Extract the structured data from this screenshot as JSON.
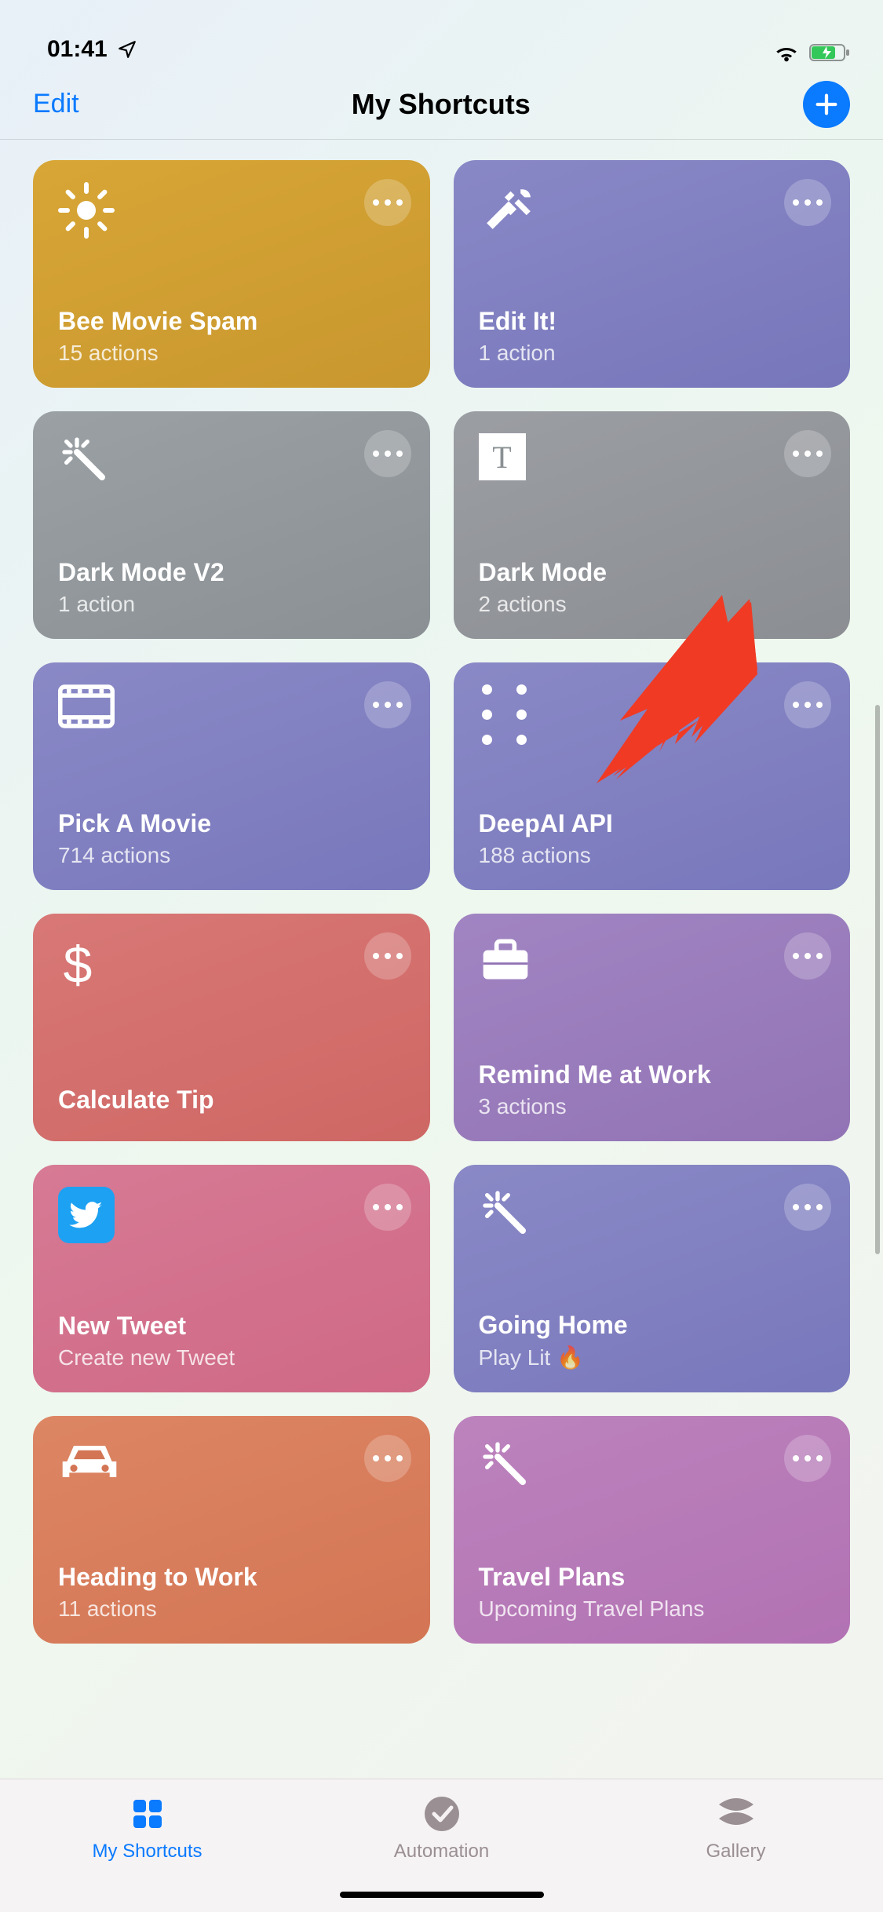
{
  "status": {
    "time": "01:41"
  },
  "nav": {
    "edit": "Edit",
    "title": "My Shortcuts"
  },
  "shortcuts": [
    {
      "title": "Bee Movie Spam",
      "sub": "15 actions",
      "color": "c-gold",
      "icon": "sun"
    },
    {
      "title": "Edit It!",
      "sub": "1 action",
      "color": "c-purple",
      "icon": "hammer-wrench"
    },
    {
      "title": "Dark Mode V2",
      "sub": "1 action",
      "color": "c-gray",
      "icon": "wand"
    },
    {
      "title": "Dark Mode",
      "sub": "2 actions",
      "color": "c-gray2",
      "icon": "text-box"
    },
    {
      "title": "Pick A Movie",
      "sub": "714 actions",
      "color": "c-purple2",
      "icon": "film"
    },
    {
      "title": "DeepAI API",
      "sub": "188 actions",
      "color": "c-purple2",
      "icon": "six-dots"
    },
    {
      "title": "Calculate Tip",
      "sub": "",
      "color": "c-red",
      "icon": "dollar"
    },
    {
      "title": "Remind Me at Work",
      "sub": "3 actions",
      "color": "c-violet",
      "icon": "briefcase"
    },
    {
      "title": "New Tweet",
      "sub": "Create new Tweet",
      "color": "c-pink",
      "icon": "twitter"
    },
    {
      "title": "Going Home",
      "sub": "Play Lit 🔥",
      "color": "c-purple2",
      "icon": "wand"
    },
    {
      "title": "Heading to Work",
      "sub": "11 actions",
      "color": "c-orange",
      "icon": "car"
    },
    {
      "title": "Travel Plans",
      "sub": "Upcoming Travel Plans",
      "color": "c-mauve",
      "icon": "wand"
    }
  ],
  "tabs": {
    "my_shortcuts": "My Shortcuts",
    "automation": "Automation",
    "gallery": "Gallery"
  }
}
